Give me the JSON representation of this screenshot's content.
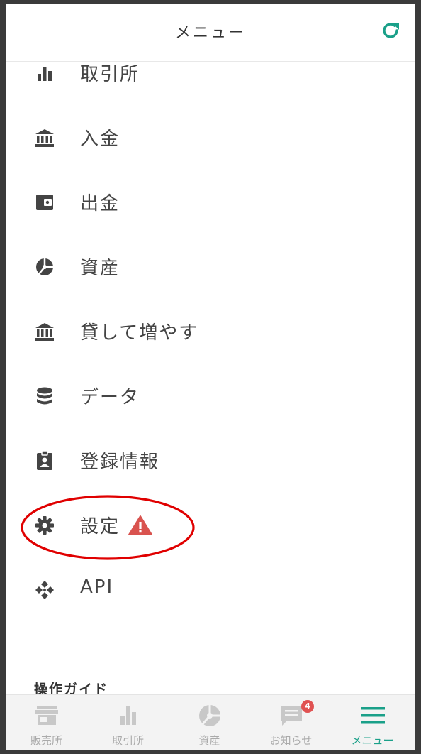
{
  "header": {
    "title": "メニュー",
    "refresh_icon": "refresh-icon"
  },
  "menu": [
    {
      "label": "取引所",
      "icon": "bar-chart-icon"
    },
    {
      "label": "入金",
      "icon": "bank-icon"
    },
    {
      "label": "出金",
      "icon": "wallet-icon"
    },
    {
      "label": "資産",
      "icon": "pie-chart-icon"
    },
    {
      "label": "貸して増やす",
      "icon": "bank-icon"
    },
    {
      "label": "データ",
      "icon": "database-icon"
    },
    {
      "label": "登録情報",
      "icon": "id-badge-icon"
    },
    {
      "label": "設定",
      "icon": "gear-icon",
      "warning_icon": "warning-triangle-icon"
    },
    {
      "label": "API",
      "icon": "api-diamond-icon"
    }
  ],
  "section_heading": "操作ガイド",
  "tabs": [
    {
      "label": "販売所",
      "icon": "shop-icon"
    },
    {
      "label": "取引所",
      "icon": "bar-chart-icon"
    },
    {
      "label": "資産",
      "icon": "pie-chart-icon"
    },
    {
      "label": "お知らせ",
      "icon": "chat-icon",
      "badge": "4"
    },
    {
      "label": "メニュー",
      "icon": "hamburger-icon",
      "active": true
    }
  ],
  "colors": {
    "accent": "#1aa089",
    "icon": "#444444",
    "warning": "#d9534f",
    "highlight": "#e00000"
  }
}
